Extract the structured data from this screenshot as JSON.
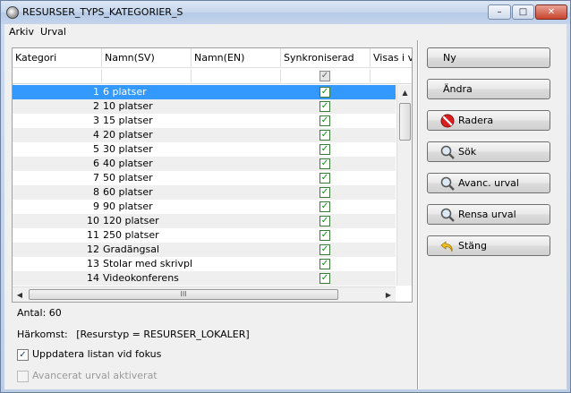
{
  "window": {
    "title": "RESURSER_TYPS_KATEGORIER_S",
    "minimize_glyph": "–",
    "maximize_glyph": "□",
    "close_glyph": "✕"
  },
  "menu": [
    "Arkiv",
    "Urval"
  ],
  "grid": {
    "columns": [
      "Kategori",
      "Namn(SV)",
      "Namn(EN)",
      "Synkroniserad",
      "Visas i v"
    ],
    "rows": [
      {
        "kategori": "1",
        "namn_sv": "6 platser"
      },
      {
        "kategori": "2",
        "namn_sv": "10 platser"
      },
      {
        "kategori": "3",
        "namn_sv": "15 platser"
      },
      {
        "kategori": "4",
        "namn_sv": "20 platser"
      },
      {
        "kategori": "5",
        "namn_sv": "30 platser"
      },
      {
        "kategori": "6",
        "namn_sv": "40 platser"
      },
      {
        "kategori": "7",
        "namn_sv": "50 platser"
      },
      {
        "kategori": "8",
        "namn_sv": "60 platser"
      },
      {
        "kategori": "9",
        "namn_sv": "90 platser"
      },
      {
        "kategori": "10",
        "namn_sv": "120 platser"
      },
      {
        "kategori": "11",
        "namn_sv": "250 platser"
      },
      {
        "kategori": "12",
        "namn_sv": "Gradängsal"
      },
      {
        "kategori": "13",
        "namn_sv": "Stolar med skrivpl..."
      },
      {
        "kategori": "14",
        "namn_sv": "Videokonferens"
      }
    ],
    "check_glyph": "✓",
    "hscroll_grip": "III",
    "scroll_up": "▲",
    "scroll_left": "◀",
    "scroll_right": "▶"
  },
  "info": {
    "count": "Antal: 60",
    "origin_label": "Härkomst:",
    "origin_value": "[Resurstyp = RESURSER_LOKALER]"
  },
  "options": {
    "update_label": "Uppdatera listan vid fokus",
    "update_checked_glyph": "✓",
    "advanced_label": "Avancerat urval aktiverat"
  },
  "buttons": {
    "ny": "Ny",
    "andra": "Ändra",
    "radera": "Radera",
    "sok": "Sök",
    "avanc": "Avanc. urval",
    "rensa": "Rensa urval",
    "stang": "Stäng"
  },
  "colors": {
    "selection": "#3399ff",
    "check_green": "#0a8a0a",
    "delete_red": "#d81e1e"
  }
}
